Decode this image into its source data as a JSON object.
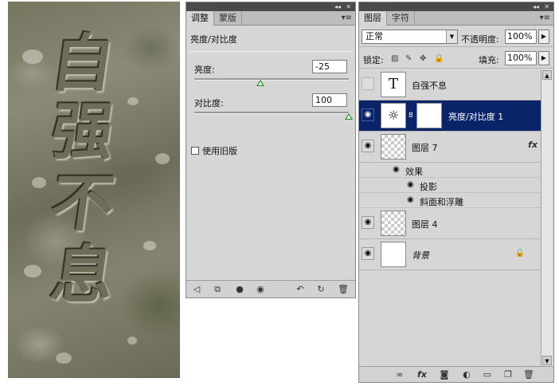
{
  "artwork": {
    "characters": [
      "自",
      "强",
      "不",
      "息"
    ]
  },
  "adjustments": {
    "tabs": [
      {
        "label": "调整"
      },
      {
        "label": "蒙版"
      }
    ],
    "title": "亮度/对比度",
    "brightness": {
      "label": "亮度:",
      "value": "-25",
      "slider_fraction": 0.43
    },
    "contrast": {
      "label": "对比度:",
      "value": "100",
      "slider_fraction": 1.0
    },
    "legacy_label": "使用旧版"
  },
  "layers": {
    "tabs": [
      {
        "label": "图层"
      },
      {
        "label": "字符"
      }
    ],
    "blend_mode": "正常",
    "opacity_label": "不透明度:",
    "opacity_value": "100%",
    "lock_label": "锁定:",
    "fill_label": "填充:",
    "fill_value": "100%",
    "items": [
      {
        "name": "自强不息",
        "type": "text",
        "visible": false,
        "selected": false
      },
      {
        "name": "亮度/对比度 1",
        "type": "adjustment",
        "visible": true,
        "selected": true
      },
      {
        "name": "图层 7",
        "type": "pixel",
        "visible": true,
        "selected": false,
        "fx": "fx"
      },
      {
        "name": "图层 4",
        "type": "pixel",
        "visible": true,
        "selected": false
      },
      {
        "name": "背景",
        "type": "background",
        "visible": true,
        "selected": false
      }
    ],
    "effects": {
      "label": "效果",
      "items": [
        "投影",
        "斜面和浮雕"
      ]
    },
    "thumb_text": "T"
  },
  "colors": {
    "selection": "#0a246a",
    "panel": "#d6d6d6",
    "slider_thumb": "#2a8a2a"
  }
}
